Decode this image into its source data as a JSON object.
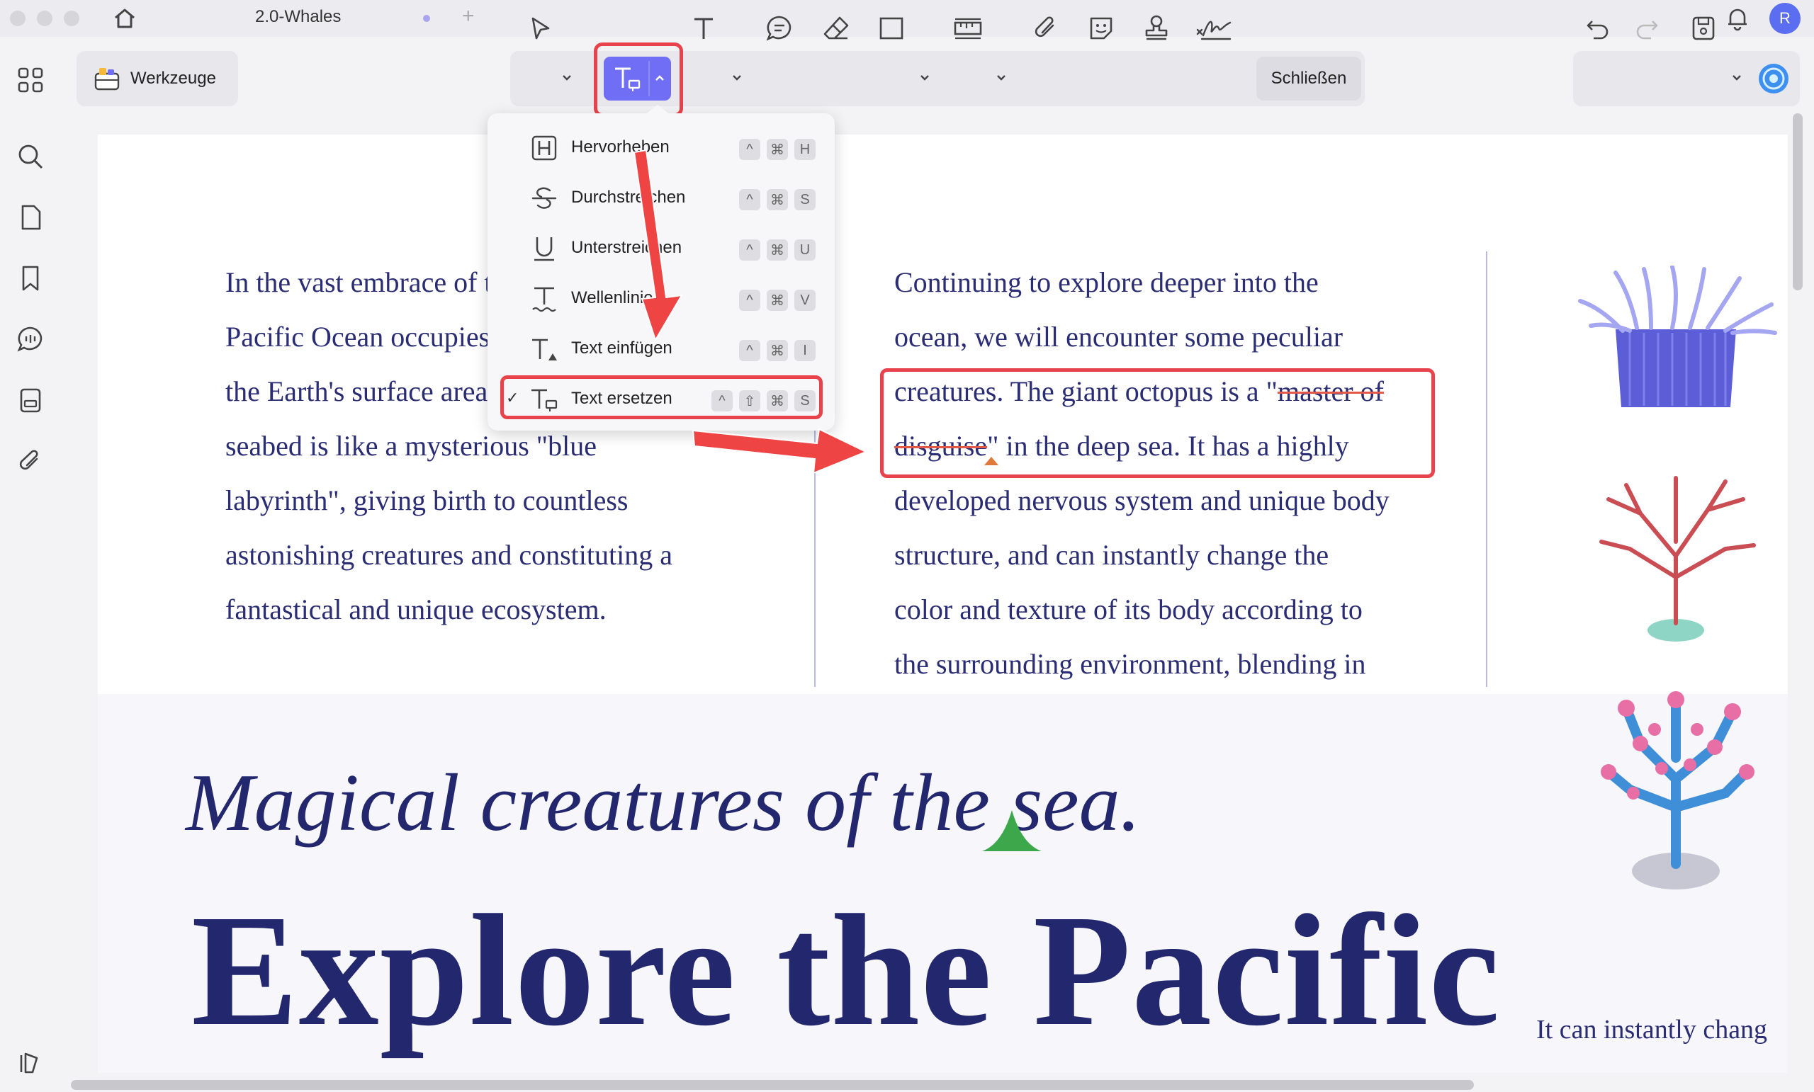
{
  "titlebar": {
    "tab_title": "2.0-Whales",
    "new_tab": "+",
    "avatar_initial": "R"
  },
  "tools": {
    "werkzeuge_label": "Werkzeuge",
    "close_label": "Schließen"
  },
  "dropdown": {
    "items": [
      {
        "label": "Hervorheben",
        "keys": [
          "^",
          "⌘",
          "H"
        ],
        "checked": false
      },
      {
        "label": "Durchstreichen",
        "keys": [
          "^",
          "⌘",
          "S"
        ],
        "checked": false
      },
      {
        "label": "Unterstreichen",
        "keys": [
          "^",
          "⌘",
          "U"
        ],
        "checked": false
      },
      {
        "label": "Wellenlinie",
        "keys": [
          "^",
          "⌘",
          "V"
        ],
        "checked": false
      },
      {
        "label": "Text einfügen",
        "keys": [
          "^",
          "⌘",
          "I"
        ],
        "checked": false
      },
      {
        "label": "Text ersetzen",
        "keys": [
          "^",
          "⇧",
          "⌘",
          "S"
        ],
        "checked": true
      }
    ],
    "check_mark": "✓"
  },
  "document": {
    "col1_lines": [
      "In the vast embrace of the",
      "Pacific Ocean occupies most of",
      "the Earth's surface area, the",
      "seabed is like a mysterious \"blue",
      "labyrinth\", giving birth to countless",
      "astonishing creatures and constituting a",
      "fantastical and unique ecosystem."
    ],
    "col2": {
      "line1": "Continuing to explore deeper into the",
      "line2": "ocean, we will encounter some peculiar",
      "line3_pre": "creatures. The giant octopus is a \"",
      "line3_strike": "master of",
      "line4_strike": "disguise",
      "line4_post": "\" in the deep sea. It has a highly",
      "line5": "developed nervous system and unique body",
      "line6": "structure, and can instantly change the",
      "line7": "color and texture of its body according to",
      "line8": "the surrounding environment, blending in"
    },
    "italic_title": "Magical creatures of the sea.",
    "big_title": "Explore the Pacific",
    "side_caption": "It can instantly chang"
  },
  "colors": {
    "accent": "#6f6ef4",
    "highlight_red": "#e8434c",
    "doc_text": "#2a2d73"
  }
}
